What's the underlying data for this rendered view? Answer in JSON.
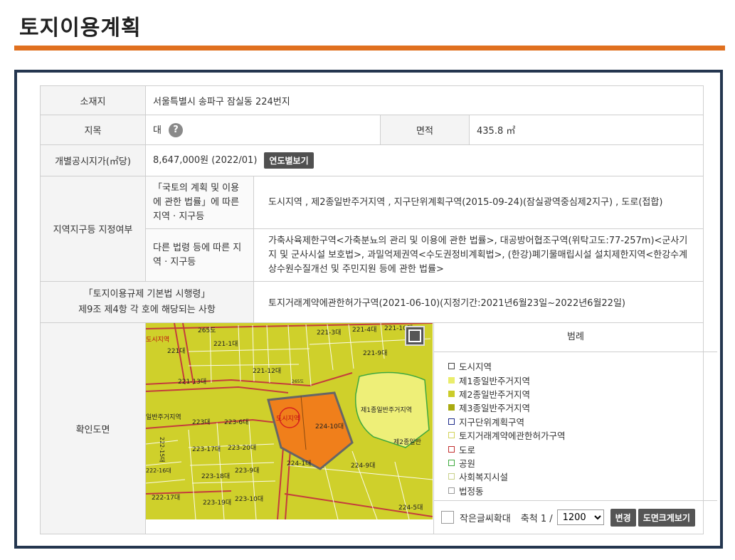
{
  "page": {
    "title": "토지이용계획"
  },
  "info": {
    "location_label": "소재지",
    "location_value": "서울특별시 송파구 잠실동 224번지",
    "jimok_label": "지목",
    "jimok_value": "대",
    "help_glyph": "?",
    "area_label": "면적",
    "area_value": "435.8 ㎡",
    "price_label": "개별공시지가(㎡당)",
    "price_value": "8,647,000원 (2022/01)",
    "price_button": "연도별보기",
    "zone_label": "지역지구등 지정여부",
    "law1_label": "「국토의 계획 및 이용에 관한 법률」에 따른 지역 · 지구등",
    "law1_value": "도시지역 , 제2종일반주거지역 , 지구단위계획구역(2015-09-24)(잠실광역중심제2지구) , 도로(접합)",
    "law2_label": "다른 법령 등에 따른 지역 · 지구등",
    "law2_value": "가축사육제한구역<가축분뇨의 관리 및 이용에 관한 법률>, 대공방어협조구역(위탁고도:77-257m)<군사기지 및 군사시설 보호법>, 과밀억제권역<수도권정비계획법>, (한강)폐기물매립시설 설치제한지역<한강수계 상수원수질개선 및 주민지원 등에 관한 법률>",
    "law3_label_line1": "「토지이용규제 기본법 시행령」",
    "law3_label_line2": "제9조 제4항 각 호에 해당되는 사항",
    "law3_value": "토지거래계약에관한허가구역(2021-06-10)(지정기간:2021년6월23일~2022년6월22일)",
    "map_label": "확인도면"
  },
  "map": {
    "labels": {
      "l265a": "265도",
      "l221_3": "221-3대",
      "l221_4": "221-4대",
      "l221_10": "221-10대",
      "l221_1": "221-1대",
      "l221": "221대",
      "l221_9": "221-9대",
      "l221_12": "221-12대",
      "l221_13": "221-13대",
      "l265b": "265도",
      "l224": "도시지역",
      "l224_10": "224-10대",
      "park": "제1종일반주거지역",
      "zone2": "제2종일반",
      "l223": "223대",
      "l223_6": "223-6대",
      "l223_17": "223-17대",
      "l223_20": "223-20대",
      "l224_1": "224-1대",
      "l224_9": "224-9대",
      "l223_18": "223-18대",
      "l223_9": "223-9대",
      "l222_17": "222-17대",
      "l223_19": "223-19대",
      "l223_10": "223-10대",
      "l224_5": "224-5대",
      "zone_left": "일반주거지역",
      "city_left": "도시지역",
      "l222_16": "222-16대",
      "l222_15": "222-15대"
    },
    "colors": {
      "zone2": "#cfd02b",
      "zone2_dark": "#b8b900",
      "zone1": "#eeef78",
      "subject": "#f07f1b",
      "road": "#c43c3c",
      "park": "#3ea83e",
      "subject_border": "#666666"
    }
  },
  "legend": {
    "title": "범례",
    "items": [
      {
        "label": "도시지역",
        "color": "#ffffff",
        "border": "#444444"
      },
      {
        "label": "제1종일반주거지역",
        "color": "#eaed6c",
        "border": "#eaed6c"
      },
      {
        "label": "제2종일반주거지역",
        "color": "#cbcc2a",
        "border": "#cbcc2a"
      },
      {
        "label": "제3종일반주거지역",
        "color": "#a9aa10",
        "border": "#a9aa10"
      },
      {
        "label": "지구단위계획구역",
        "color": "#ffffff",
        "border": "#1d2a8a"
      },
      {
        "label": "토지거래계약에관한허가구역",
        "color": "#ffffff",
        "border": "#d3d35a"
      },
      {
        "label": "도로",
        "color": "#ffffff",
        "border": "#c23030"
      },
      {
        "label": "공원",
        "color": "#ffffff",
        "border": "#3eaa3e"
      },
      {
        "label": "사회복지시설",
        "color": "#ffffff",
        "border": "#c9d08a"
      },
      {
        "label": "법정동",
        "color": "#ffffff",
        "border": "#999999"
      }
    ],
    "small_text_label": "작은글씨확대",
    "scale_label": "축척 1 /",
    "scale_value": "1200",
    "change_button": "변경",
    "fullscreen_button": "도면크게보기"
  }
}
